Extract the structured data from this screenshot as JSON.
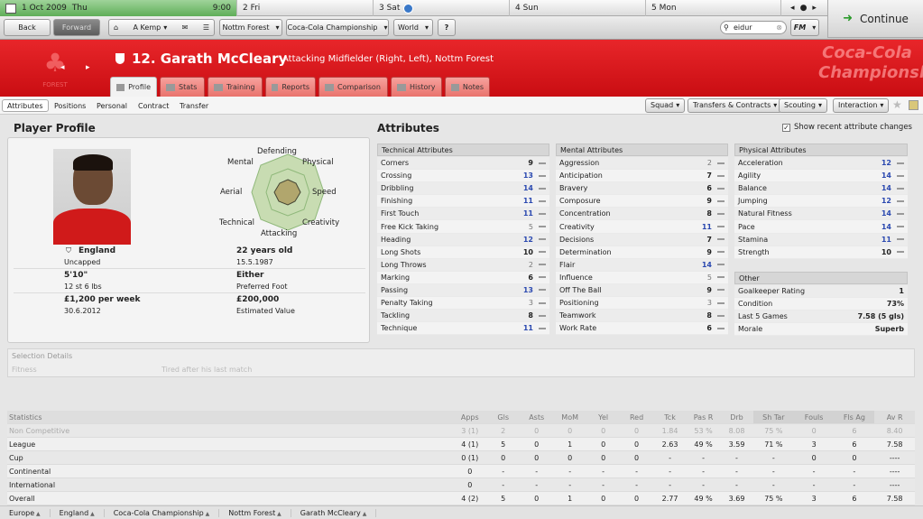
{
  "calendar": {
    "today_date": "1 Oct 2009",
    "today_day": "Thu",
    "time": "9:00",
    "days": [
      "2 Fri",
      "3 Sat",
      "4 Sun",
      "5 Mon"
    ]
  },
  "continue_label": "Continue",
  "nav": {
    "back": "Back",
    "forward": "Forward",
    "manager": "A Kemp",
    "club": "Nottm Forest",
    "competition": "Coca-Cola Championship",
    "world": "World",
    "help": "?",
    "search_value": "eidur",
    "fm": "FM"
  },
  "player": {
    "number_name": "12. Garath McCleary",
    "role": "Attacking Midfielder (Right, Left), Nottm Forest"
  },
  "crest_text": "FOREST",
  "sponsor_text": "Coca-Cola Championship",
  "tabs": [
    "Profile",
    "Stats",
    "Training",
    "Reports",
    "Comparison",
    "History",
    "Notes"
  ],
  "subtabs": [
    "Attributes",
    "Positions",
    "Personal",
    "Contract",
    "Transfer"
  ],
  "actions": [
    "Squad",
    "Transfers & Contracts",
    "Scouting",
    "Interaction"
  ],
  "profile": {
    "title": "Player Profile",
    "nation": "England",
    "caps": "Uncapped",
    "age": "22 years old",
    "dob": "15.5.1987",
    "height": "5'10\"",
    "weight": "12 st 6 lbs",
    "foot": "Either",
    "foot_label": "Preferred Foot",
    "wage": "£1,200 per week",
    "contract_end": "30.6.2012",
    "value": "£200,000",
    "value_label": "Estimated Value",
    "radar_labels": [
      "Defending",
      "Physical",
      "Speed",
      "Creativity",
      "Attacking",
      "Technical",
      "Aerial",
      "Mental"
    ]
  },
  "attributes_title": "Attributes",
  "show_recent": "Show recent attribute changes",
  "technical": {
    "title": "Technical Attributes",
    "rows": [
      [
        "Corners",
        "9"
      ],
      [
        "Crossing",
        "13"
      ],
      [
        "Dribbling",
        "14"
      ],
      [
        "Finishing",
        "11"
      ],
      [
        "First Touch",
        "11"
      ],
      [
        "Free Kick Taking",
        "5"
      ],
      [
        "Heading",
        "12"
      ],
      [
        "Long Shots",
        "10"
      ],
      [
        "Long Throws",
        "2"
      ],
      [
        "Marking",
        "6"
      ],
      [
        "Passing",
        "13"
      ],
      [
        "Penalty Taking",
        "3"
      ],
      [
        "Tackling",
        "8"
      ],
      [
        "Technique",
        "11"
      ]
    ]
  },
  "mental": {
    "title": "Mental Attributes",
    "rows": [
      [
        "Aggression",
        "2"
      ],
      [
        "Anticipation",
        "7"
      ],
      [
        "Bravery",
        "6"
      ],
      [
        "Composure",
        "9"
      ],
      [
        "Concentration",
        "8"
      ],
      [
        "Creativity",
        "11"
      ],
      [
        "Decisions",
        "7"
      ],
      [
        "Determination",
        "9"
      ],
      [
        "Flair",
        "14"
      ],
      [
        "Influence",
        "5"
      ],
      [
        "Off The Ball",
        "9"
      ],
      [
        "Positioning",
        "3"
      ],
      [
        "Teamwork",
        "8"
      ],
      [
        "Work Rate",
        "6"
      ]
    ]
  },
  "physical": {
    "title": "Physical Attributes",
    "rows": [
      [
        "Acceleration",
        "12"
      ],
      [
        "Agility",
        "14"
      ],
      [
        "Balance",
        "14"
      ],
      [
        "Jumping",
        "12"
      ],
      [
        "Natural Fitness",
        "14"
      ],
      [
        "Pace",
        "14"
      ],
      [
        "Stamina",
        "11"
      ],
      [
        "Strength",
        "10"
      ]
    ]
  },
  "other": {
    "title": "Other",
    "rows": [
      [
        "Goalkeeper Rating",
        "1"
      ],
      [
        "Condition",
        "73%"
      ],
      [
        "Last 5 Games",
        "7.58 (5 gls)"
      ],
      [
        "Morale",
        "Superb"
      ]
    ]
  },
  "selection": {
    "title": "Selection Details",
    "fitness_label": "Fitness",
    "fitness_value": "Tired after his last match"
  },
  "stats": {
    "headers": [
      "Statistics",
      "Apps",
      "Gls",
      "Asts",
      "MoM",
      "Yel",
      "Red",
      "Tck",
      "Pas R",
      "Drb",
      "Sh Tar",
      "Fouls",
      "Fls Ag",
      "Av R"
    ],
    "rows": [
      [
        "Non Competitive",
        "3 (1)",
        "2",
        "0",
        "0",
        "0",
        "0",
        "1.84",
        "53 %",
        "8.08",
        "75 %",
        "0",
        "6",
        "8.40"
      ],
      [
        "League",
        "4 (1)",
        "5",
        "0",
        "1",
        "0",
        "0",
        "2.63",
        "49 %",
        "3.59",
        "71 %",
        "3",
        "6",
        "7.58"
      ],
      [
        "Cup",
        "0 (1)",
        "0",
        "0",
        "0",
        "0",
        "0",
        "-",
        "-",
        "-",
        "-",
        "0",
        "0",
        "----"
      ],
      [
        "Continental",
        "0",
        "-",
        "-",
        "-",
        "-",
        "-",
        "-",
        "-",
        "-",
        "-",
        "-",
        "-",
        "----"
      ],
      [
        "International",
        "0",
        "-",
        "-",
        "-",
        "-",
        "-",
        "-",
        "-",
        "-",
        "-",
        "-",
        "-",
        "----"
      ],
      [
        "Overall",
        "4 (2)",
        "5",
        "0",
        "1",
        "0",
        "0",
        "2.77",
        "49 %",
        "3.69",
        "75 %",
        "3",
        "6",
        "7.58"
      ]
    ]
  },
  "breadcrumb": [
    "Europe",
    "England",
    "Coca-Cola Championship",
    "Nottm Forest",
    "Garath McCleary"
  ]
}
